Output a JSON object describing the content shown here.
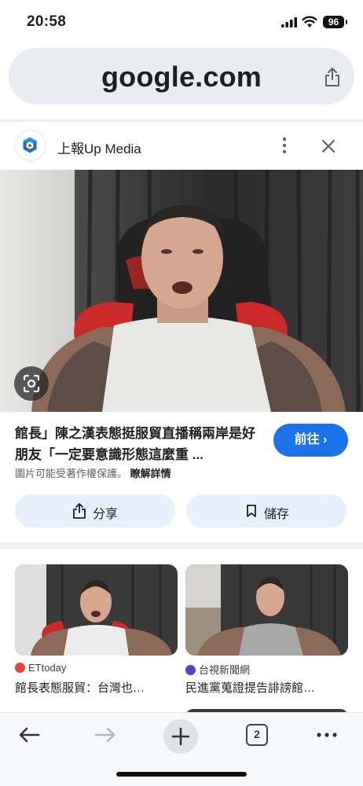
{
  "status_bar": {
    "time": "20:58",
    "battery": "96"
  },
  "url_bar": {
    "domain": "google.com"
  },
  "source": {
    "name": "上報Up Media"
  },
  "article": {
    "title": "館長」陳之漢表態挺服貿直播稱兩岸是好朋友「一定要意識形態這麼重 ...",
    "go_label": "前往 ›",
    "copyright_text": "圖片可能受著作權保護。",
    "learn_more": "瞭解詳情",
    "share_label": "分享",
    "save_label": "儲存"
  },
  "related": [
    {
      "source": "ETtoday",
      "title": "館長表態服貿：台灣也…",
      "source_color": "#e8453c"
    },
    {
      "source": "台視新聞網",
      "title": "民進黨蒐證提告誹謗館…",
      "source_color": "#5b3fc4"
    }
  ],
  "toolbar": {
    "tab_count": "2"
  },
  "colors": {
    "accent": "#1a73e8",
    "chip_bg": "#e8f0fe",
    "url_bg": "#e9ecf1"
  }
}
